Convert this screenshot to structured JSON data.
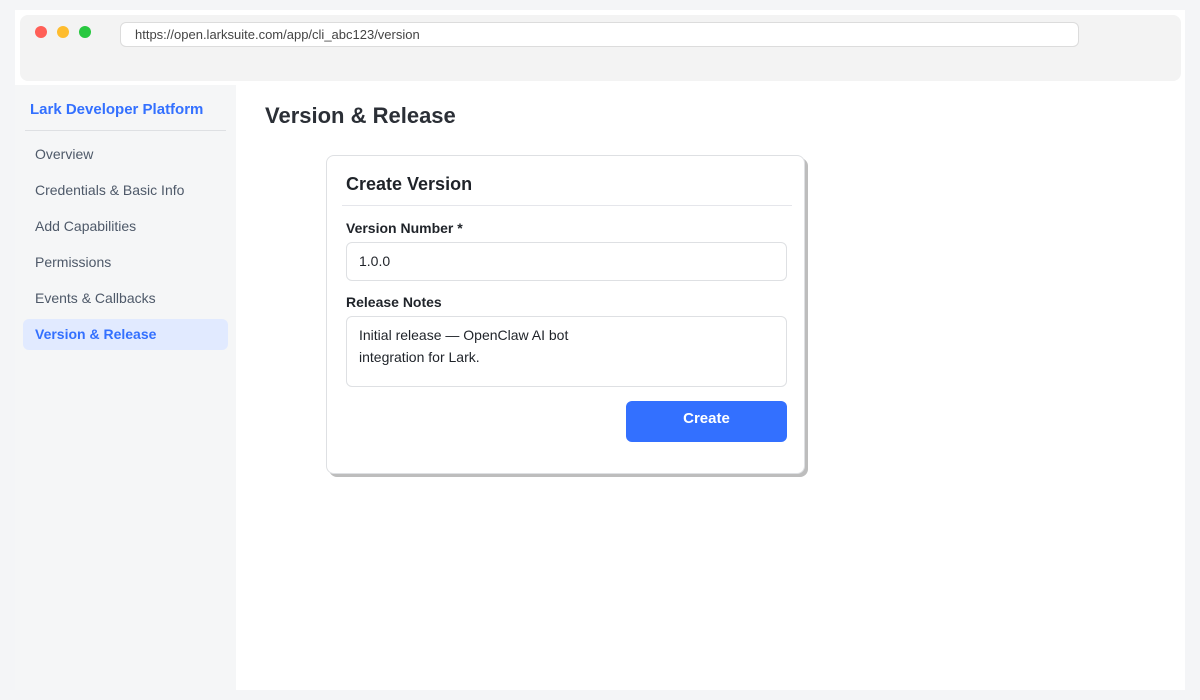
{
  "browser": {
    "url": "https://open.larksuite.com/app/cli_abc123/version"
  },
  "sidebar": {
    "brand": "Lark Developer Platform",
    "items": [
      {
        "label": "Overview",
        "active": false
      },
      {
        "label": "Credentials & Basic Info",
        "active": false
      },
      {
        "label": "Add Capabilities",
        "active": false
      },
      {
        "label": "Permissions",
        "active": false
      },
      {
        "label": "Events & Callbacks",
        "active": false
      },
      {
        "label": "Version & Release",
        "active": true
      }
    ]
  },
  "main": {
    "title": "Version & Release",
    "card": {
      "title": "Create Version",
      "version_label": "Version Number *",
      "version_value": "1.0.0",
      "notes_label": "Release Notes",
      "notes_lines": [
        "Initial release — OpenClaw AI bot",
        "integration for Lark."
      ],
      "create_label": "Create"
    }
  },
  "colors": {
    "accent": "#3370ff",
    "active_nav_bg": "#e1eaff",
    "close_dot": "#ff5f57",
    "minimize_dot": "#febc2e",
    "maximize_dot": "#28c840"
  }
}
